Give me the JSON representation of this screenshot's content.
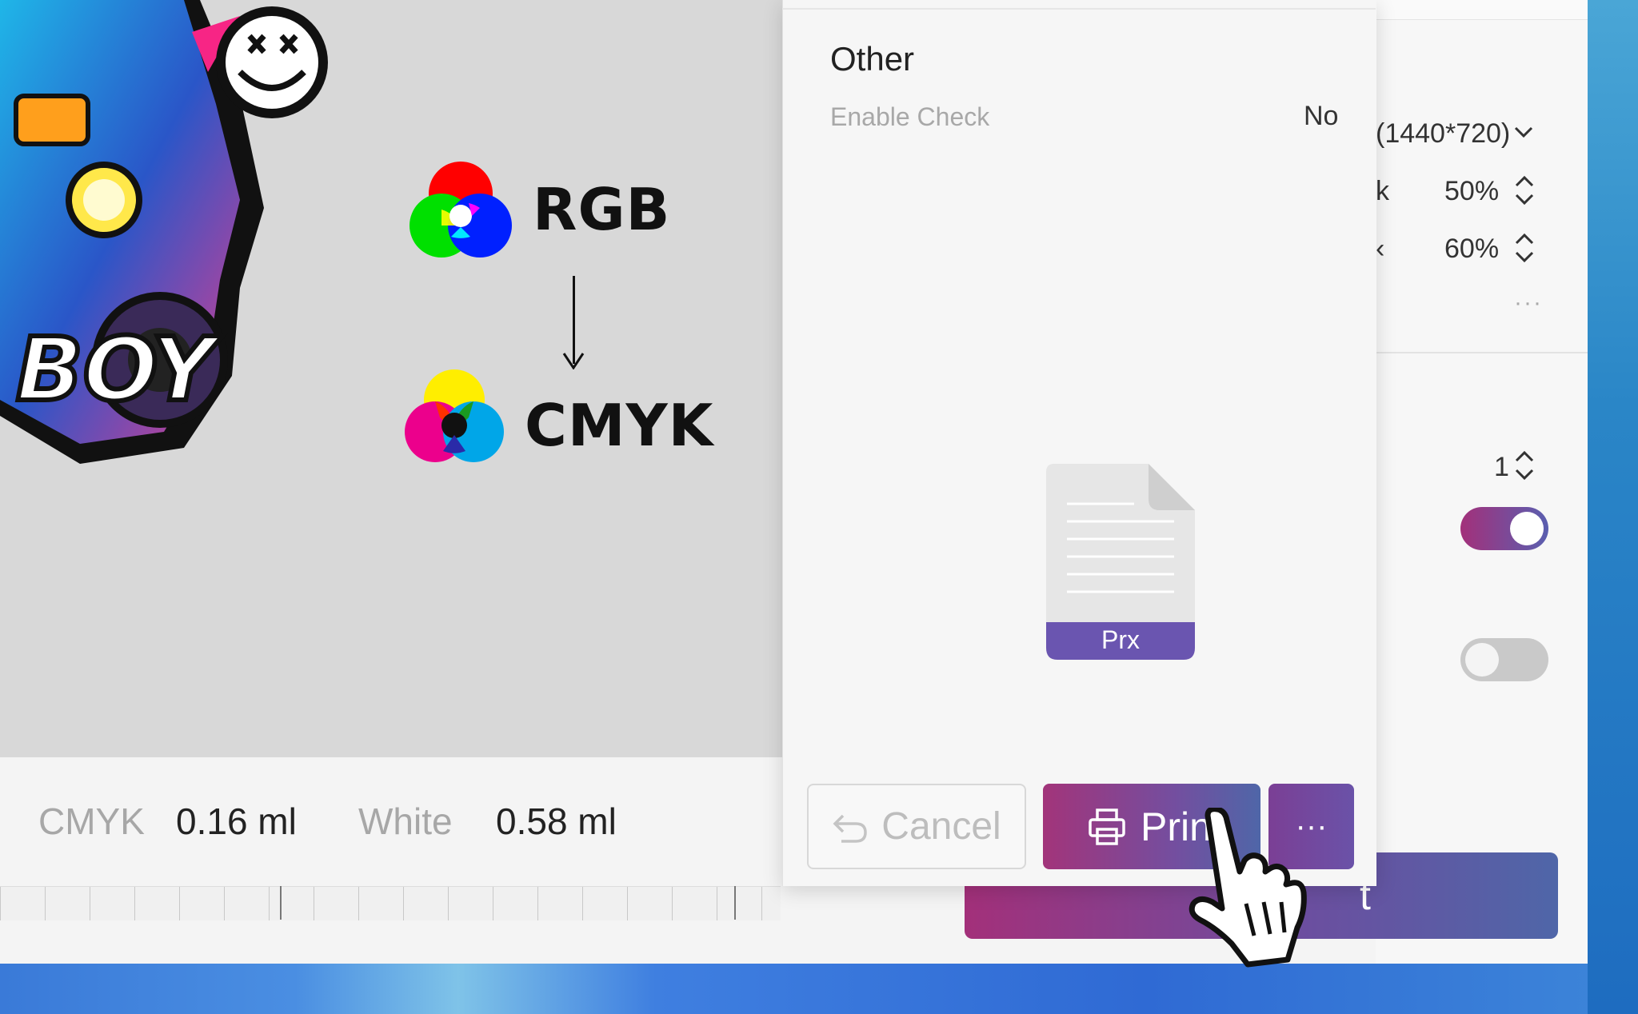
{
  "canvas": {
    "conversion": {
      "from": "RGB",
      "to": "CMYK"
    }
  },
  "stats": {
    "cmyk_label": "CMYK",
    "cmyk_value": "0.16 ml",
    "white_label": "White",
    "white_value": "0.58 ml"
  },
  "dialog": {
    "section_title": "Other",
    "enable_check_label": "Enable Check",
    "enable_check_value": "No",
    "file_type": "Prx",
    "cancel_label": "Cancel",
    "print_label": "Prin",
    "more_label": "···"
  },
  "right_panel": {
    "resolution": "(1440*720)",
    "row1_partial": "k",
    "row1_value": "50%",
    "row2_partial": "‹",
    "row2_value": "60%",
    "more": "···",
    "copies": "1",
    "toggle1_on": true,
    "toggle2_on": false,
    "print_partial": "t"
  },
  "colors": {
    "accent_start": "#a3307a",
    "accent_end": "#4f66a8"
  }
}
